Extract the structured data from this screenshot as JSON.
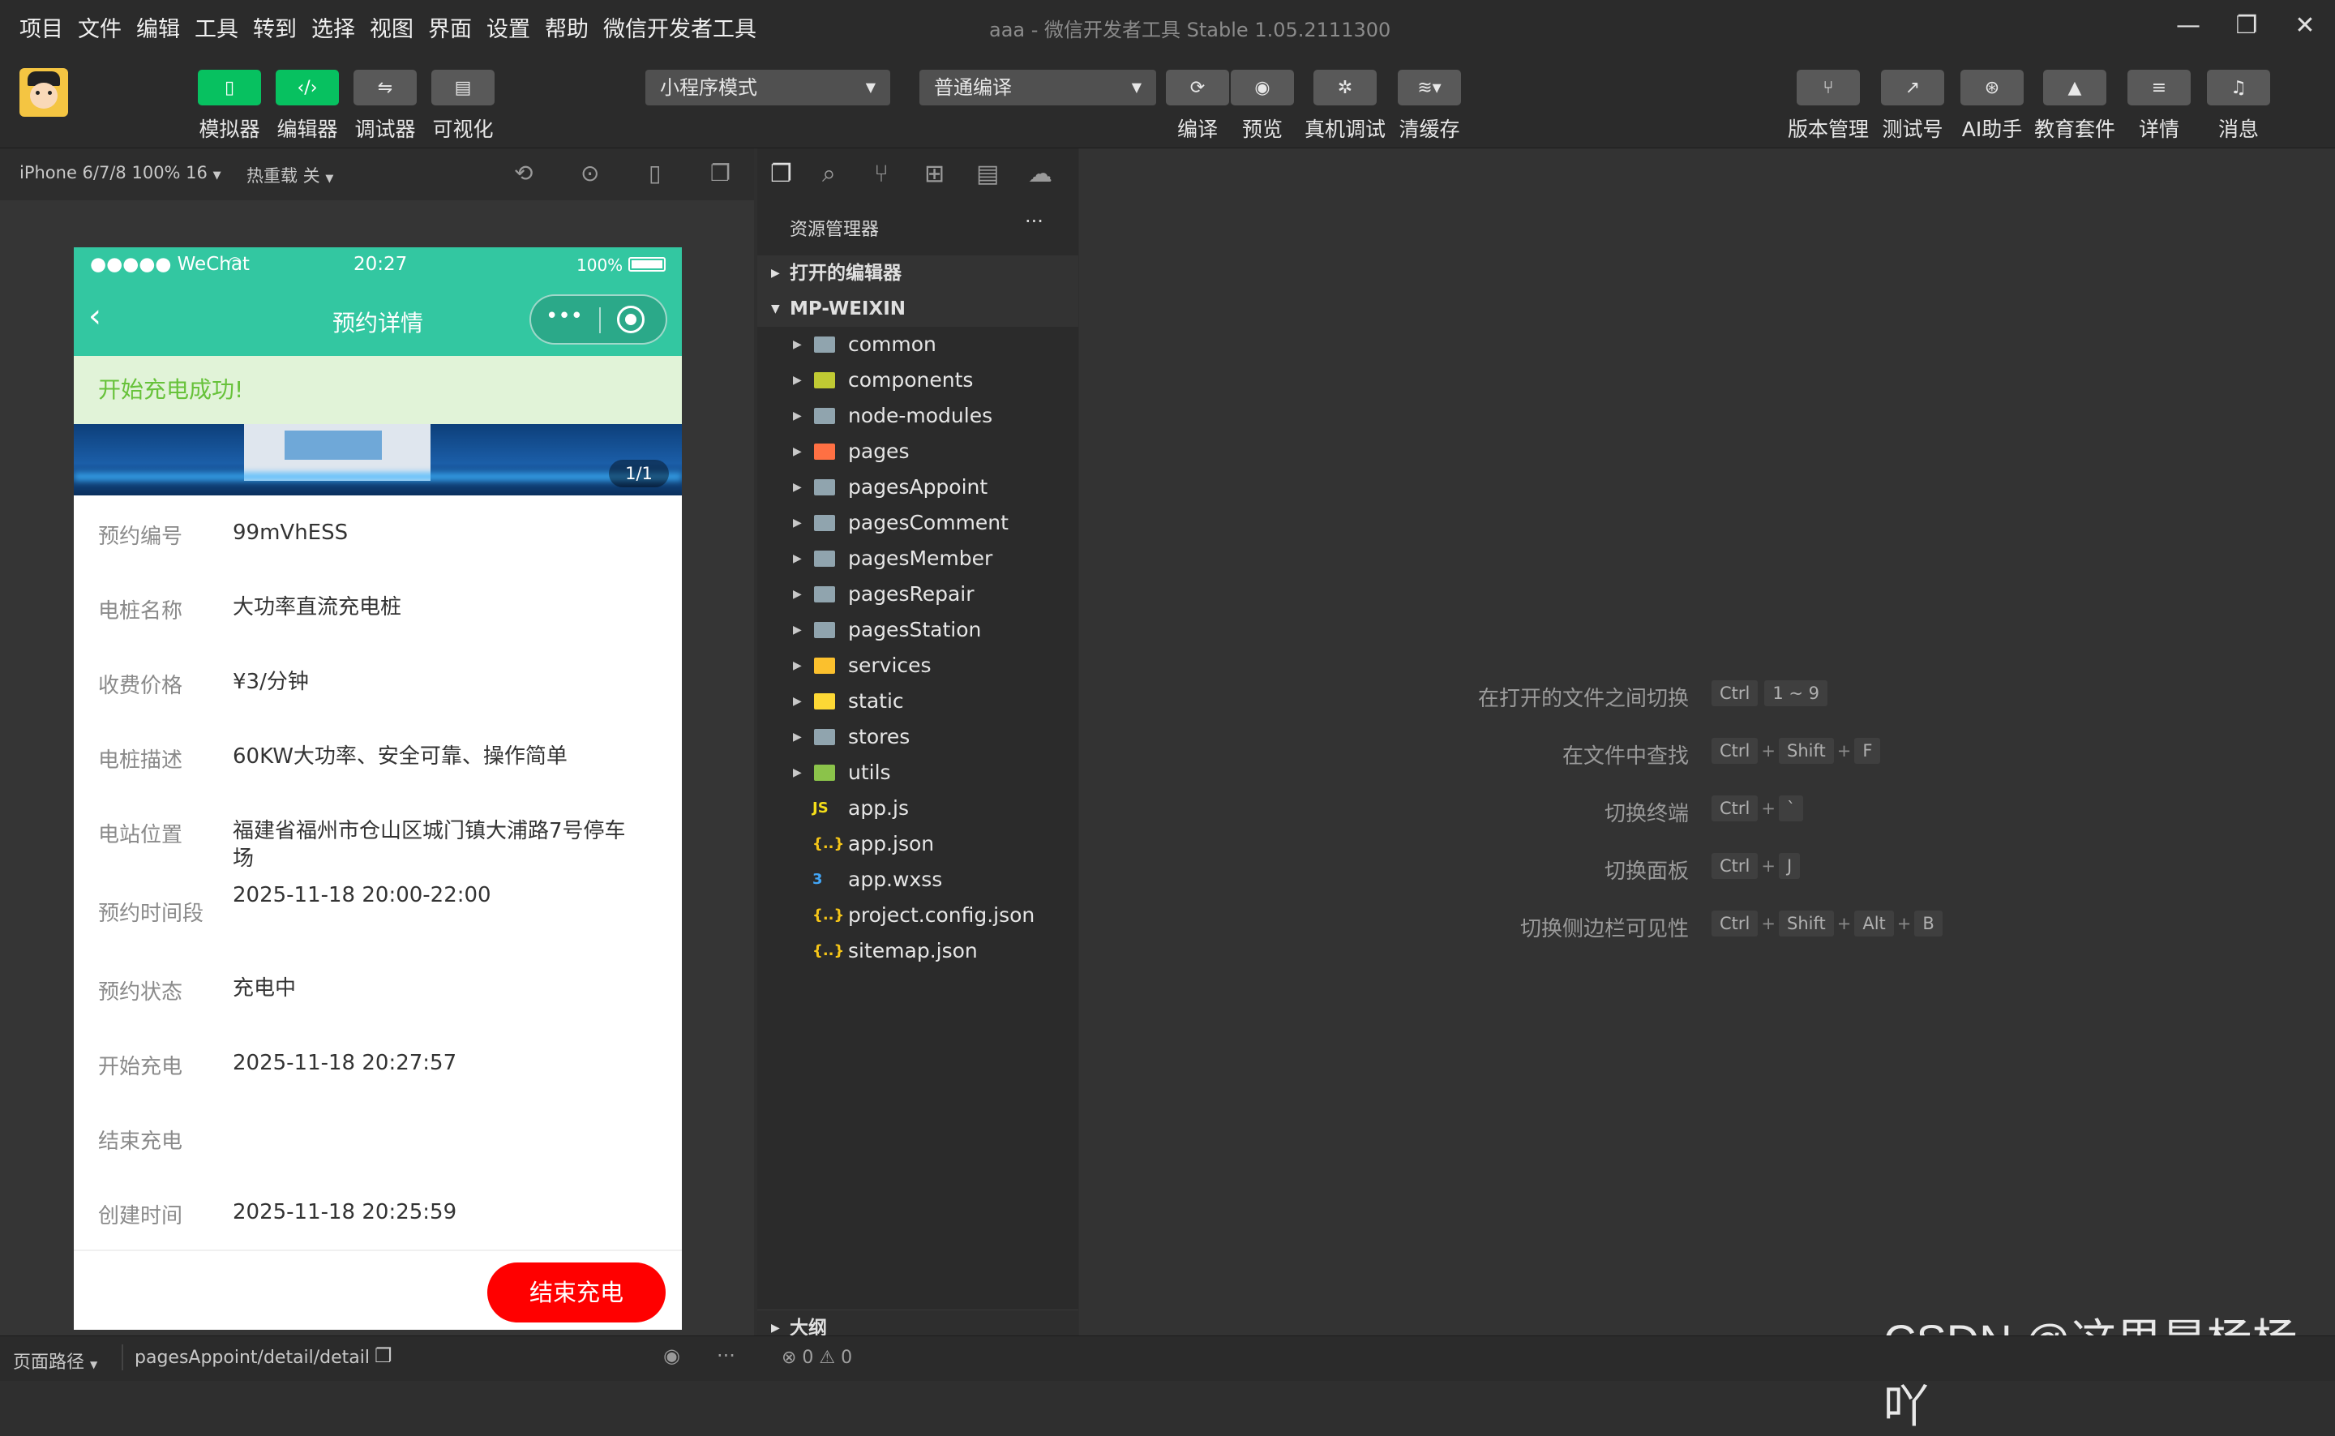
{
  "menu": [
    "项目",
    "文件",
    "编辑",
    "工具",
    "转到",
    "选择",
    "视图",
    "界面",
    "设置",
    "帮助",
    "微信开发者工具"
  ],
  "window_title": "aaa - 微信开发者工具 Stable 1.05.2111300",
  "window_controls": {
    "minimize": "—",
    "maximize": "❐",
    "close": "✕"
  },
  "toolbar": {
    "left_buttons": [
      {
        "label": "模拟器",
        "icon": "phone-icon"
      },
      {
        "label": "编辑器",
        "icon": "code-icon"
      },
      {
        "label": "调试器",
        "icon": "sliders-icon"
      },
      {
        "label": "可视化",
        "icon": "layout-icon"
      }
    ],
    "mode_select": "小程序模式",
    "compile_select": "普通编译",
    "compile_buttons": [
      {
        "label": "编译",
        "icon": "refresh-icon"
      },
      {
        "label": "预览",
        "icon": "eye-icon"
      },
      {
        "label": "真机调试",
        "icon": "bug-icon"
      },
      {
        "label": "清缓存",
        "icon": "layers-icon"
      }
    ],
    "right_buttons": [
      {
        "label": "版本管理",
        "icon": "branch-icon"
      },
      {
        "label": "测试号",
        "icon": "external-link-icon"
      },
      {
        "label": "AI助手",
        "icon": "ai-icon"
      },
      {
        "label": "教育套件",
        "icon": "graduation-cap-icon"
      },
      {
        "label": "详情",
        "icon": "menu-icon"
      },
      {
        "label": "消息",
        "icon": "bell-icon"
      }
    ]
  },
  "simulator": {
    "device": "iPhone 6/7/8 100% 16",
    "hot_reload": "热重载 关",
    "phone": {
      "status": {
        "left": "●●●●● WeChat",
        "time": "20:27",
        "battery": "100%"
      },
      "nav_title": "预约详情",
      "toast": "开始充电成功!",
      "swiper_indicator": "1/1",
      "rows": [
        {
          "label": "预约编号",
          "value": "99mVhESS"
        },
        {
          "label": "电桩名称",
          "value": "大功率直流充电桩"
        },
        {
          "label": "收费价格",
          "value": "¥3/分钟"
        },
        {
          "label": "电桩描述",
          "value": "60KW大功率、安全可靠、操作简单"
        },
        {
          "label": "电站位置",
          "value": "福建省福州市仓山区城门镇大浦路7号停车场"
        },
        {
          "label": "预约时间段",
          "value": "2025-11-18 20:00-22:00"
        },
        {
          "label": "预约状态",
          "value": "充电中"
        },
        {
          "label": "开始充电",
          "value": "2025-11-18 20:27:57"
        },
        {
          "label": "结束充电",
          "value": ""
        },
        {
          "label": "创建时间",
          "value": "2025-11-18 20:25:59"
        }
      ],
      "end_button": "结束充电"
    }
  },
  "explorer": {
    "title": "资源管理器",
    "more": "···",
    "open_editors": "打开的编辑器",
    "project": "MP-WEIXIN",
    "items": [
      {
        "name": "common",
        "type": "folder",
        "color": "#90a4ae"
      },
      {
        "name": "components",
        "type": "folder",
        "color": "#c0ca33"
      },
      {
        "name": "node-modules",
        "type": "folder",
        "color": "#90a4ae"
      },
      {
        "name": "pages",
        "type": "folder",
        "color": "#ff7043"
      },
      {
        "name": "pagesAppoint",
        "type": "folder",
        "color": "#90a4ae"
      },
      {
        "name": "pagesComment",
        "type": "folder",
        "color": "#90a4ae"
      },
      {
        "name": "pagesMember",
        "type": "folder",
        "color": "#90a4ae"
      },
      {
        "name": "pagesRepair",
        "type": "folder",
        "color": "#90a4ae"
      },
      {
        "name": "pagesStation",
        "type": "folder",
        "color": "#90a4ae"
      },
      {
        "name": "services",
        "type": "folder",
        "color": "#fbc02d"
      },
      {
        "name": "static",
        "type": "folder",
        "color": "#fdd835"
      },
      {
        "name": "stores",
        "type": "folder",
        "color": "#90a4ae"
      },
      {
        "name": "utils",
        "type": "folder",
        "color": "#8bc34a"
      },
      {
        "name": "app.js",
        "type": "file",
        "glyph": "JS",
        "color": "#f5de19"
      },
      {
        "name": "app.json",
        "type": "file",
        "glyph": "{..}",
        "color": "#f5c518"
      },
      {
        "name": "app.wxss",
        "type": "file",
        "glyph": "3",
        "color": "#42a5f5"
      },
      {
        "name": "project.config.json",
        "type": "file",
        "glyph": "{..}",
        "color": "#f5c518"
      },
      {
        "name": "sitemap.json",
        "type": "file",
        "glyph": "{..}",
        "color": "#f5c518"
      }
    ],
    "outline": "大纲",
    "problems": "⊗ 0 ⚠ 0"
  },
  "shortcuts": [
    {
      "label": "在打开的文件之间切换",
      "keys": [
        "Ctrl",
        "1 ~ 9"
      ]
    },
    {
      "label": "在文件中查找",
      "keys": [
        "Ctrl",
        "+",
        "Shift",
        "+",
        "F"
      ]
    },
    {
      "label": "切换终端",
      "keys": [
        "Ctrl",
        "+",
        "`"
      ]
    },
    {
      "label": "切换面板",
      "keys": [
        "Ctrl",
        "+",
        "J"
      ]
    },
    {
      "label": "切换侧边栏可见性",
      "keys": [
        "Ctrl",
        "+",
        "Shift",
        "+",
        "Alt",
        "+",
        "B"
      ]
    }
  ],
  "statusbar": {
    "page_path_label": "页面路径",
    "page_path": "pagesAppoint/detail/detail",
    "more": "···"
  },
  "watermark": "CSDN @这里是杨杨吖"
}
